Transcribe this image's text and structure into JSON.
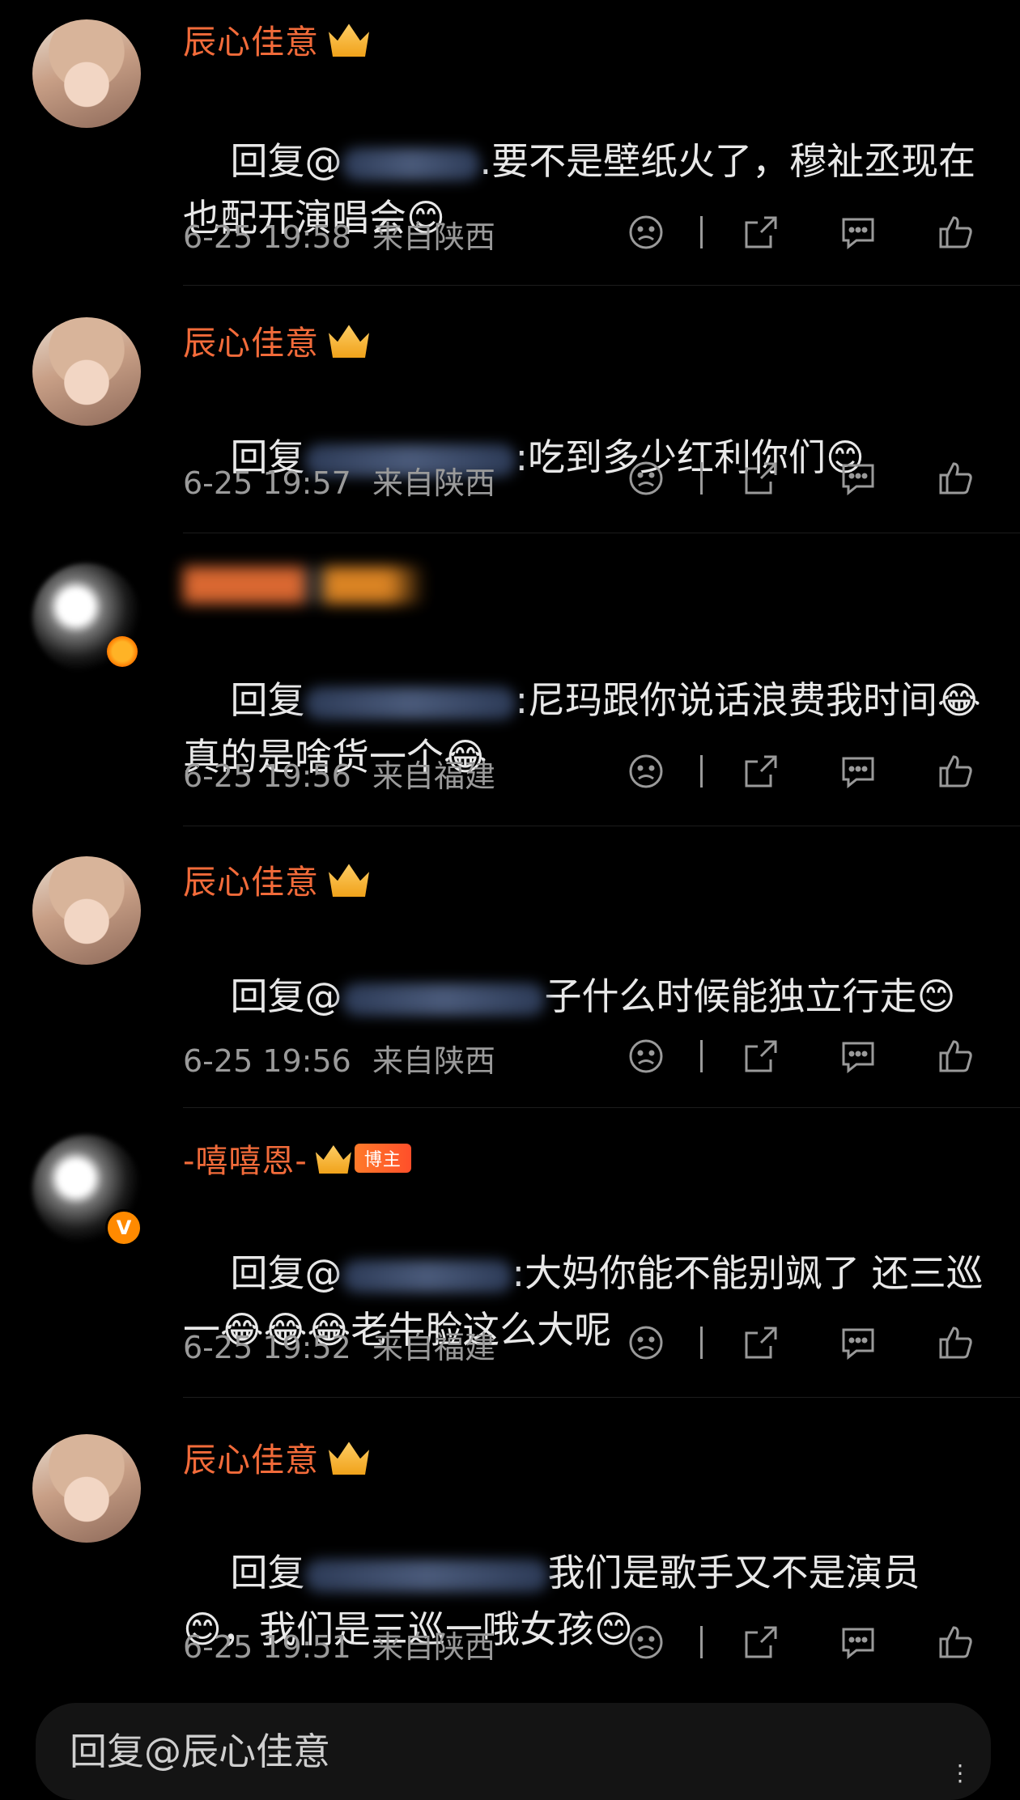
{
  "comments": [
    {
      "name": "辰心佳意",
      "text_before": "回复@",
      "text_after": ".要不是壁纸火了，穆祉丞现在也配开演唱会😊",
      "time": "6-25 19:58",
      "location": "来自陕西"
    },
    {
      "name": "辰心佳意",
      "text_before": "回复",
      "text_after": ":吃到多少红利你们😊",
      "time": "6-25 19:57",
      "location": "来自陕西"
    },
    {
      "name": "",
      "text_before": "回复",
      "text_after": ":尼玛跟你说话浪费我时间😂 真的是啥货一个😂",
      "time": "6-25 19:56",
      "location": "来自福建"
    },
    {
      "name": "辰心佳意",
      "text_before": "回复@",
      "text_after": "子什么时候能独立行走😊",
      "time": "6-25 19:56",
      "location": "来自陕西"
    },
    {
      "name": "-嘻嘻恩-",
      "badge": "博主",
      "text_before": "回复@",
      "text_after": ":大妈你能不能别飒了 还三巡一😂😂😂老牛脸这么大呢",
      "time": "6-25 19:52",
      "location": "来自福建"
    },
    {
      "name": "辰心佳意",
      "text_before": "回复",
      "text_after": "我们是歌手又不是演员😊，我们是三巡一哦女孩😊",
      "time": "6-25 19:51",
      "location": "来自陕西"
    }
  ],
  "reply_bar": {
    "label": "回复@辰心佳意"
  },
  "icons": {
    "dislike": "frown-face-icon",
    "share": "share-icon",
    "comment": "comment-bubble-icon",
    "like": "thumbs-up-icon",
    "crown": "crown-icon",
    "verified": "verified-v-icon"
  },
  "colors": {
    "background": "#000000",
    "username": "#f26b3a",
    "text": "#e8e8e8",
    "meta": "#9a9a9a"
  }
}
